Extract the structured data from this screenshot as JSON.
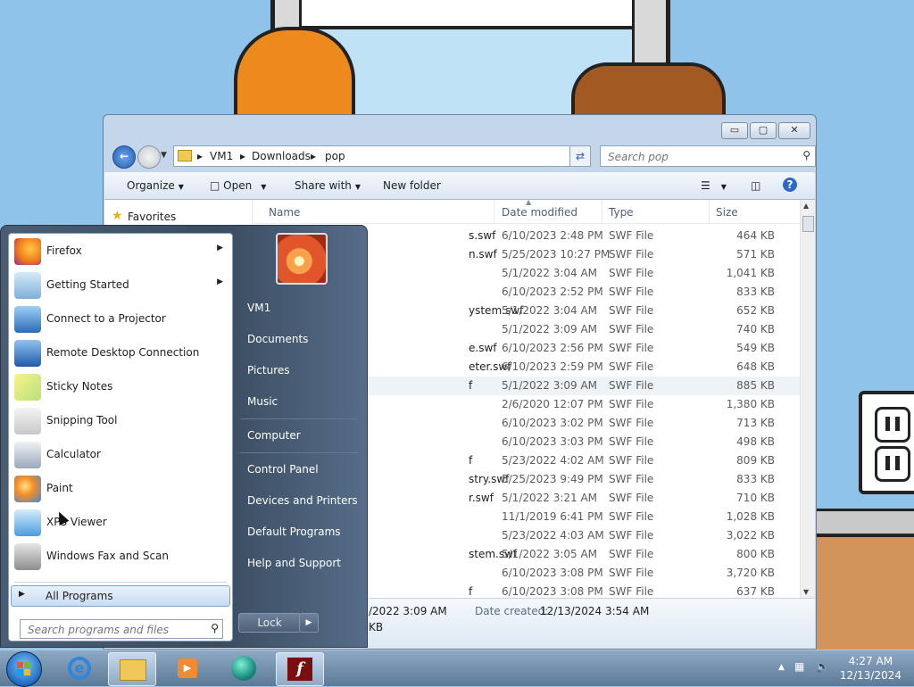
{
  "explorer": {
    "caption_buttons": [
      "▭",
      "▢",
      "✕"
    ],
    "breadcrumb": [
      "VM1",
      "Downloads",
      "pop"
    ],
    "search_placeholder": "Search pop",
    "toolbar": {
      "organize": "Organize",
      "open": "Open",
      "share_with": "Share with",
      "new_folder": "New folder"
    },
    "nav": {
      "favorites": "Favorites"
    },
    "columns": {
      "name": "Name",
      "date": "Date modified",
      "type": "Type",
      "size": "Size"
    },
    "rows": [
      {
        "name": "s.swf",
        "date": "6/10/2023 2:48 PM",
        "type": "SWF File",
        "size": "464 KB"
      },
      {
        "name": "n.swf",
        "date": "5/25/2023 10:27 PM",
        "type": "SWF File",
        "size": "571 KB"
      },
      {
        "name": "",
        "date": "5/1/2022 3:04 AM",
        "type": "SWF File",
        "size": "1,041 KB"
      },
      {
        "name": "",
        "date": "6/10/2023 2:52 PM",
        "type": "SWF File",
        "size": "833 KB"
      },
      {
        "name": "ystem.swf",
        "date": "5/1/2022 3:04 AM",
        "type": "SWF File",
        "size": "652 KB"
      },
      {
        "name": "",
        "date": "5/1/2022 3:09 AM",
        "type": "SWF File",
        "size": "740 KB"
      },
      {
        "name": "e.swf",
        "date": "6/10/2023 2:56 PM",
        "type": "SWF File",
        "size": "549 KB"
      },
      {
        "name": "eter.swf",
        "date": "6/10/2023 2:59 PM",
        "type": "SWF File",
        "size": "648 KB"
      },
      {
        "name": "f",
        "date": "5/1/2022 3:09 AM",
        "type": "SWF File",
        "size": "885 KB"
      },
      {
        "name": "",
        "date": "2/6/2020 12:07 PM",
        "type": "SWF File",
        "size": "1,380 KB"
      },
      {
        "name": "",
        "date": "6/10/2023 3:02 PM",
        "type": "SWF File",
        "size": "713 KB"
      },
      {
        "name": "",
        "date": "6/10/2023 3:03 PM",
        "type": "SWF File",
        "size": "498 KB"
      },
      {
        "name": "f",
        "date": "5/23/2022 4:02 AM",
        "type": "SWF File",
        "size": "809 KB"
      },
      {
        "name": "stry.swf",
        "date": "5/25/2023 9:49 PM",
        "type": "SWF File",
        "size": "833 KB"
      },
      {
        "name": "r.swf",
        "date": "5/1/2022 3:21 AM",
        "type": "SWF File",
        "size": "710 KB"
      },
      {
        "name": "",
        "date": "11/1/2019 6:41 PM",
        "type": "SWF File",
        "size": "1,028 KB"
      },
      {
        "name": "",
        "date": "5/23/2022 4:03 AM",
        "type": "SWF File",
        "size": "3,022 KB"
      },
      {
        "name": "stem.swf",
        "date": "5/1/2022 3:05 AM",
        "type": "SWF File",
        "size": "800 KB"
      },
      {
        "name": "",
        "date": "6/10/2023 3:08 PM",
        "type": "SWF File",
        "size": "3,720 KB"
      },
      {
        "name": "f",
        "date": "6/10/2023 3:08 PM",
        "type": "SWF File",
        "size": "637 KB"
      }
    ],
    "details": {
      "modified_fragment": "/2022 3:09 AM",
      "size_fragment": "KB",
      "date_created_label": "Date created:",
      "date_created_value": "12/13/2024 3:54 AM"
    }
  },
  "start_menu": {
    "programs": [
      {
        "label": "Firefox",
        "icon": "firefox-icon",
        "submenu": true
      },
      {
        "label": "Getting Started",
        "icon": "getting-started-icon",
        "submenu": true
      },
      {
        "label": "Connect to a Projector",
        "icon": "projector-icon",
        "submenu": false
      },
      {
        "label": "Remote Desktop Connection",
        "icon": "remote-desktop-icon",
        "submenu": false
      },
      {
        "label": "Sticky Notes",
        "icon": "sticky-notes-icon",
        "submenu": false
      },
      {
        "label": "Snipping Tool",
        "icon": "snipping-tool-icon",
        "submenu": false
      },
      {
        "label": "Calculator",
        "icon": "calculator-icon",
        "submenu": false
      },
      {
        "label": "Paint",
        "icon": "paint-icon",
        "submenu": false
      },
      {
        "label": "XPS Viewer",
        "icon": "xps-viewer-icon",
        "submenu": false
      },
      {
        "label": "Windows Fax and Scan",
        "icon": "fax-scan-icon",
        "submenu": false
      }
    ],
    "all_programs": "All Programs",
    "search_placeholder": "Search programs and files",
    "places": [
      "VM1",
      "Documents",
      "Pictures",
      "Music",
      "Computer",
      "Control Panel",
      "Devices and Printers",
      "Default Programs",
      "Help and Support"
    ],
    "lock": "Lock"
  },
  "taskbar": {
    "apps": [
      "internet-explorer-icon",
      "windows-explorer-icon",
      "media-player-icon",
      "app-globe-icon",
      "flash-player-icon"
    ],
    "time": "4:27 AM",
    "date": "12/13/2024"
  }
}
